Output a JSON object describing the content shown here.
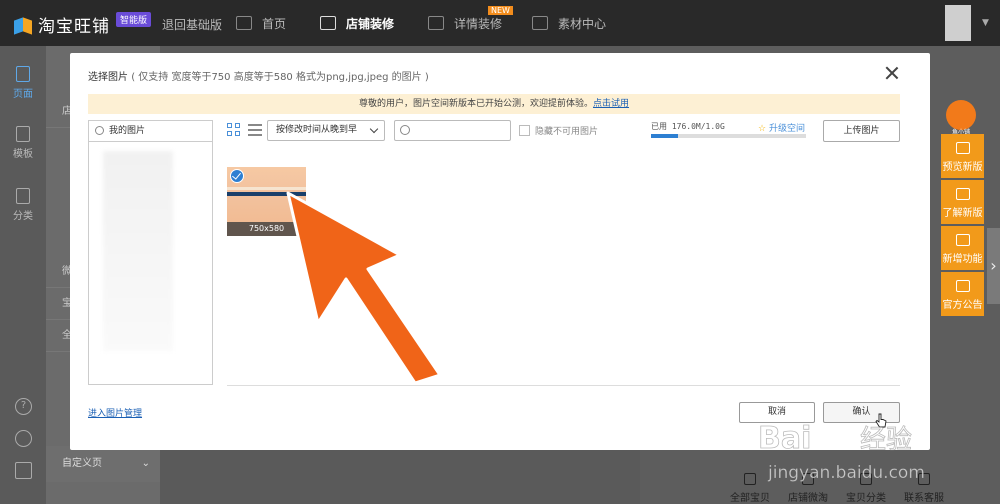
{
  "topbar": {
    "logo_text": "淘宝旺铺",
    "logo_badge": "智能版",
    "back_label": "退回基础版",
    "nav": [
      {
        "label": "首页",
        "icon": "home-icon"
      },
      {
        "label": "店铺装修",
        "icon": "store-icon",
        "active": true
      },
      {
        "label": "详情装修",
        "icon": "detail-icon",
        "badge": "NEW"
      },
      {
        "label": "素材中心",
        "icon": "folder-icon"
      }
    ]
  },
  "leftrail": {
    "items": [
      {
        "label": "页面",
        "icon": "page-icon",
        "active": true
      },
      {
        "label": "模板",
        "icon": "template-icon"
      },
      {
        "label": "分类",
        "icon": "category-icon"
      }
    ],
    "bottom_icons": [
      "help-icon",
      "headset-icon",
      "edit-icon"
    ]
  },
  "panel2": {
    "rows": [
      "店",
      "微",
      "宝",
      "全"
    ],
    "footer_label": "自定义页"
  },
  "bottomnav": {
    "items": [
      {
        "label": "全部宝贝",
        "icon": "bag-icon"
      },
      {
        "label": "店铺微淘",
        "icon": "broadcast-icon"
      },
      {
        "label": "宝贝分类",
        "icon": "list-icon"
      },
      {
        "label": "联系客服",
        "icon": "chat-icon"
      }
    ]
  },
  "floating": {
    "mascot_label": "鱼小铺",
    "buttons": [
      {
        "label": "预览新版",
        "icon": "preview-icon"
      },
      {
        "label": "了解新版",
        "icon": "info-icon"
      },
      {
        "label": "新增功能",
        "icon": "feature-icon"
      },
      {
        "label": "官方公告",
        "icon": "announcement-icon"
      }
    ]
  },
  "modal": {
    "title": "选择图片",
    "title_hint": "( 仅支持 宽度等于750 高度等于580 格式为png,jpg,jpeg 的图片 )",
    "notice_text": "尊敬的用户，图片空间新版本已开始公测，欢迎提前体验。",
    "notice_link": "点击试用",
    "album_search_placeholder": "我的图片",
    "sort_label": "按修改时间从晚到早",
    "search_placeholder": "",
    "hide_label": "隐藏不可用图片",
    "usage_text": "已用 176.0M/1.0G",
    "usage_fraction": 0.172,
    "upgrade_label": "升级空间",
    "upload_label": "上传图片",
    "thumb_caption": "750x580",
    "thumb_selected": true,
    "manage_link": "进入图片管理",
    "cancel_label": "取消",
    "confirm_label": "确认"
  },
  "watermark": {
    "brand": "Bai",
    "brand2": "经验",
    "url": "jingyan.baidu.com"
  },
  "colors": {
    "accent": "#2d7fd2",
    "notice_bg": "#fdf0d4",
    "float_orange": "#f29a1a",
    "arrow": "#f06418"
  }
}
